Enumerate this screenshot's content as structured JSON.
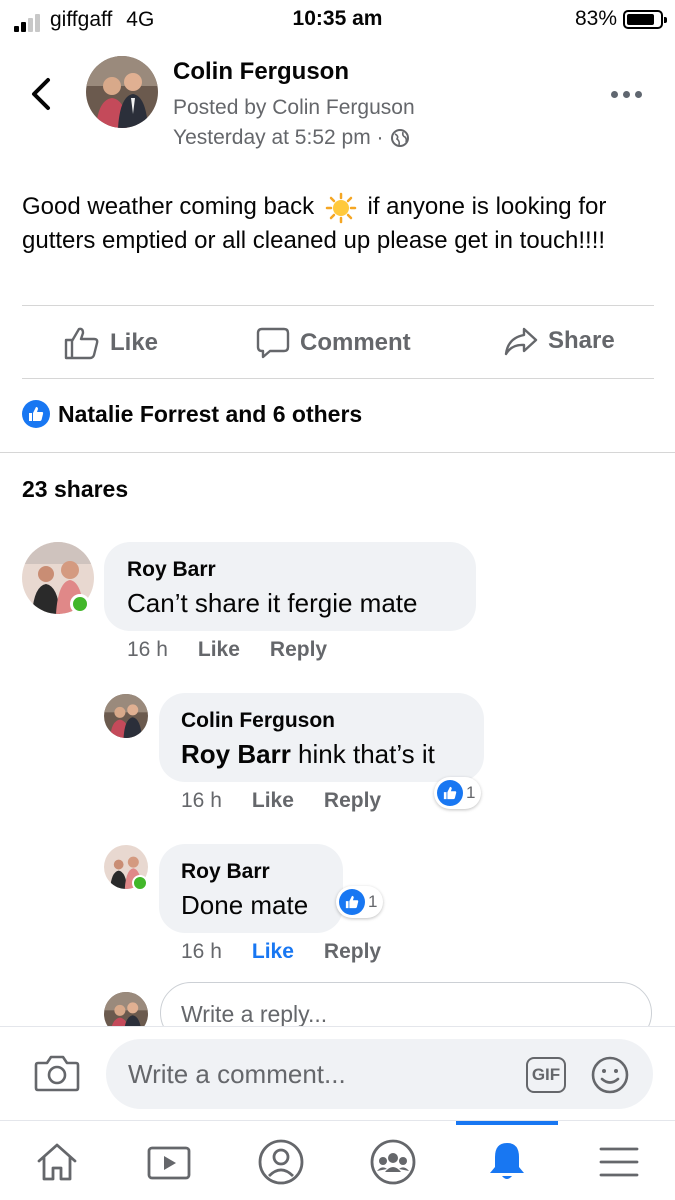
{
  "status_bar": {
    "carrier": "giffgaff",
    "network": "4G",
    "time": "10:35 am",
    "battery": "83%",
    "battery_level": 0.83
  },
  "post": {
    "author": "Colin Ferguson",
    "posted_by": "Posted by Colin Ferguson",
    "timestamp": "Yesterday at 5:52 pm ·",
    "text_part1": "Good weather coming back",
    "text_part2": "if anyone is looking for gutters emptied or all cleaned up please get in touch!!!!",
    "emoji_icon": "sun-emoji"
  },
  "actions": {
    "like": "Like",
    "comment": "Comment",
    "share": "Share"
  },
  "reactions": {
    "summary": "Natalie Forrest and 6 others"
  },
  "shares": "23 shares",
  "comments": [
    {
      "name": "Roy Barr",
      "text": "Can’t share it fergie mate",
      "time": "16 h",
      "like": "Like",
      "reply": "Reply",
      "online": true
    },
    {
      "name": "Colin Ferguson",
      "mention": "Roy Barr",
      "text": " hink that’s it",
      "time": "16 h",
      "like": "Like",
      "reply": "Reply",
      "reaction_count": "1"
    },
    {
      "name": "Roy Barr",
      "text": "Done mate",
      "time": "16 h",
      "like": "Like",
      "reply": "Reply",
      "reaction_count": "1",
      "liked": true,
      "online": true
    }
  ],
  "reply_input": {
    "placeholder": "Write a reply..."
  },
  "composer": {
    "placeholder": "Write a comment...",
    "gif": "GIF"
  },
  "tabs": [
    "home",
    "watch",
    "profile",
    "groups",
    "notifications",
    "menu"
  ],
  "colors": {
    "accent": "#1877f2",
    "secondary_text": "#65676b",
    "bubble": "#f0f2f5",
    "online": "#42b72a"
  }
}
